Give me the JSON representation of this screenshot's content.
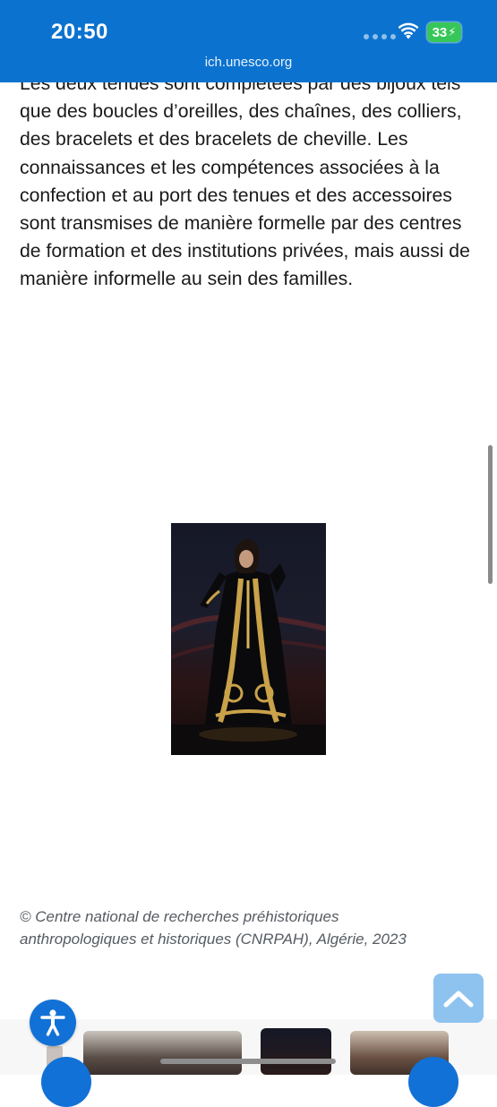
{
  "status_bar": {
    "time": "20:50",
    "battery": "33",
    "url": "ich.unesco.org"
  },
  "article": {
    "paragraph": "Les deux tenues sont complétées par des bijoux tels que des boucles d’oreilles, des chaînes, des colliers, des bracelets et des bracelets de cheville. Les connaissances et les compétences associées à la confection et au port des tenues et des accessoires sont transmises de manière formelle par des centres de formation et des institutions privées, mais aussi de manière informelle au sein des familles."
  },
  "caption": {
    "line1": "© Centre national de recherches préhistoriques",
    "line2": "anthropologiques et historiques (CNRPAH), Algérie, 2023"
  },
  "colors": {
    "topbar": "#0b72cf",
    "accent": "#1271d6",
    "back_to_top": "#8fc3ef",
    "battery": "#37c759"
  },
  "icons": {
    "wifi": "wifi-icon",
    "battery": "battery-charging-icon",
    "back_to_top": "chevron-up-icon",
    "accessibility": "accessibility-icon"
  }
}
